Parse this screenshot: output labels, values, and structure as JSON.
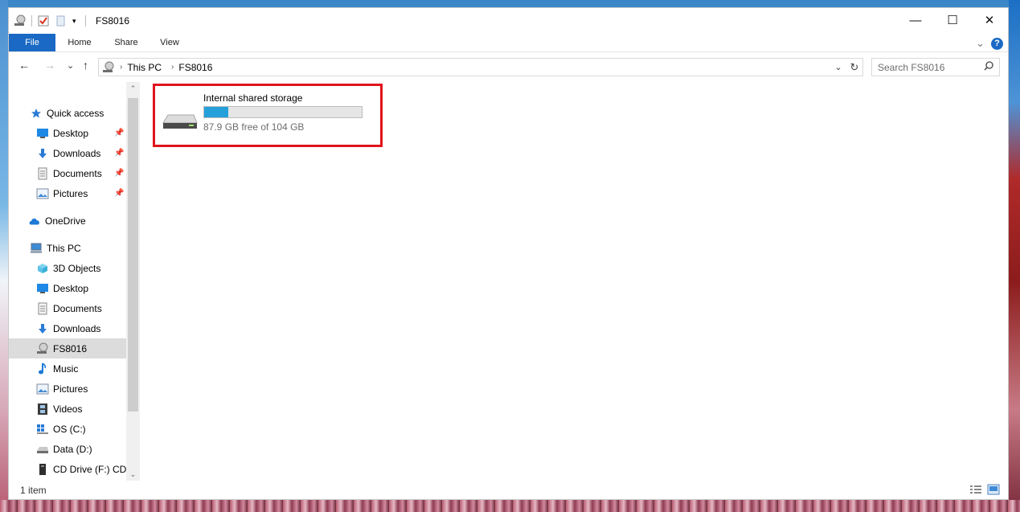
{
  "window": {
    "title": "FS8016",
    "controls": {
      "minimize": "—",
      "maximize": "☐",
      "close": "✕"
    }
  },
  "ribbon": {
    "tabs": [
      {
        "label": "File"
      },
      {
        "label": "Home"
      },
      {
        "label": "Share"
      },
      {
        "label": "View"
      }
    ],
    "help": "?",
    "expand": "⌄"
  },
  "navigation": {
    "back": "←",
    "forward": "→",
    "recent": "⌄",
    "up": "↑",
    "breadcrumb": [
      "This PC",
      "FS8016"
    ],
    "search_placeholder": "Search FS8016"
  },
  "sidebar": {
    "items": [
      {
        "label": "Quick access",
        "icon": "star-icon",
        "pinned": false
      },
      {
        "label": "Desktop",
        "icon": "desktop-icon",
        "pinned": true
      },
      {
        "label": "Downloads",
        "icon": "download-icon",
        "pinned": true
      },
      {
        "label": "Documents",
        "icon": "documents-icon",
        "pinned": true
      },
      {
        "label": "Pictures",
        "icon": "pictures-icon",
        "pinned": true
      },
      {
        "label": "OneDrive",
        "icon": "cloud-icon",
        "pinned": false
      },
      {
        "label": "This PC",
        "icon": "computer-icon",
        "pinned": false
      },
      {
        "label": "3D Objects",
        "icon": "cube-icon",
        "pinned": false
      },
      {
        "label": "Desktop",
        "icon": "desktop-icon",
        "pinned": false
      },
      {
        "label": "Documents",
        "icon": "documents-icon",
        "pinned": false
      },
      {
        "label": "Downloads",
        "icon": "download-icon",
        "pinned": false
      },
      {
        "label": "FS8016",
        "icon": "device-icon",
        "pinned": false,
        "selected": true
      },
      {
        "label": "Music",
        "icon": "music-icon",
        "pinned": false
      },
      {
        "label": "Pictures",
        "icon": "pictures-icon",
        "pinned": false
      },
      {
        "label": "Videos",
        "icon": "video-icon",
        "pinned": false
      },
      {
        "label": "OS (C:)",
        "icon": "windows-drive-icon",
        "pinned": false
      },
      {
        "label": "Data (D:)",
        "icon": "drive-icon",
        "pinned": false
      },
      {
        "label": "CD Drive (F:) CDI",
        "icon": "cd-drive-icon",
        "pinned": false
      }
    ]
  },
  "content": {
    "storage": {
      "name": "Internal shared storage",
      "free_text": "87.9 GB free of 104 GB",
      "used_fraction": 0.155,
      "bar_color": "#26a0da",
      "highlight_color": "#e0141c"
    }
  },
  "status": {
    "item_count": "1 item"
  },
  "colors": {
    "accent": "#1a69c4",
    "selected": "#dcdcdc"
  }
}
